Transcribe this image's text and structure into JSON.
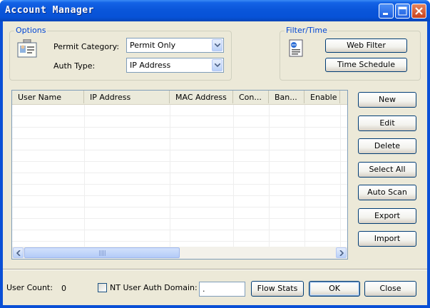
{
  "window": {
    "title": "Account Manager"
  },
  "options": {
    "group_title": "Options",
    "permit_category_label": "Permit Category:",
    "permit_category_value": "Permit Only",
    "auth_type_label": "Auth Type:",
    "auth_type_value": "IP Address"
  },
  "filter_time": {
    "group_title": "Filter/Time",
    "web_filter_label": "Web Filter",
    "time_schedule_label": "Time Schedule"
  },
  "table": {
    "columns": [
      "User Name",
      "IP Address",
      "MAC Address",
      "Con...",
      "Ban...",
      "Enable"
    ],
    "rows": []
  },
  "actions": {
    "new": "New",
    "edit": "Edit",
    "delete": "Delete",
    "select_all": "Select All",
    "auto_scan": "Auto Scan",
    "export": "Export",
    "import": "Import"
  },
  "footer": {
    "user_count_label": "User Count:",
    "user_count_value": "0",
    "nt_auth_label": "NT User Auth Domain:",
    "nt_auth_checked": false,
    "domain_value": ".",
    "flow_stats": "Flow Stats",
    "ok": "OK",
    "close": "Close"
  },
  "icons": {
    "title_buttons": [
      "minimize-icon",
      "maximize-icon",
      "close-icon"
    ],
    "options_icon": "id-card-icon",
    "filter_icon": "document-icon"
  }
}
